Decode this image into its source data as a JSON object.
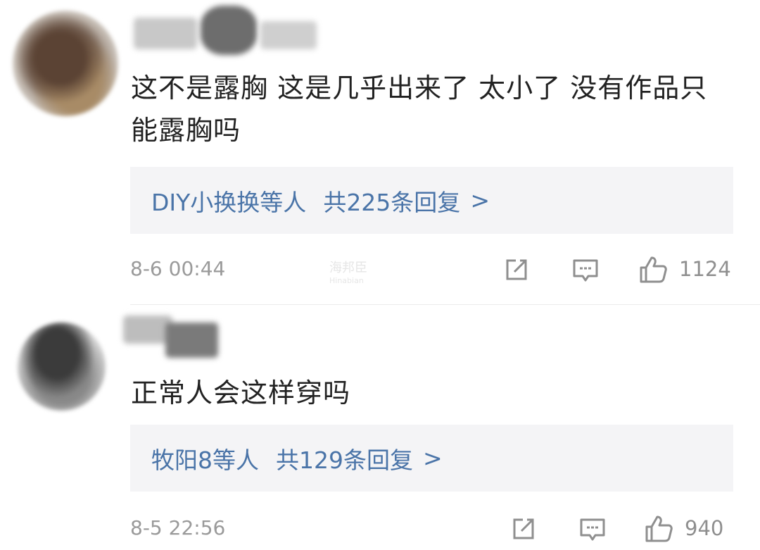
{
  "comments": [
    {
      "text": "这不是露胸 这是几乎出来了  太小了  没有作品只能露胸吗",
      "replies": {
        "names": "DIY小换换等人",
        "count_text": "共225条回复",
        "arrow": ">"
      },
      "time": "8-6 00:44",
      "likes": "1124",
      "icons": [
        "share-icon",
        "comment-icon",
        "like-icon"
      ]
    },
    {
      "text": "正常人会这样穿吗",
      "replies": {
        "names": "牧阳8等人",
        "count_text": "共129条回复",
        "arrow": ">"
      },
      "time": "8-5 22:56",
      "likes": "940",
      "icons": [
        "share-icon",
        "comment-icon",
        "like-icon"
      ]
    }
  ],
  "watermark": {
    "line1": "海邦臣",
    "line2": "Hinabian"
  },
  "colors": {
    "link": "#4a74a8",
    "text": "#222222",
    "meta": "#9a9a9a",
    "reply_bg": "#f4f4f6"
  }
}
